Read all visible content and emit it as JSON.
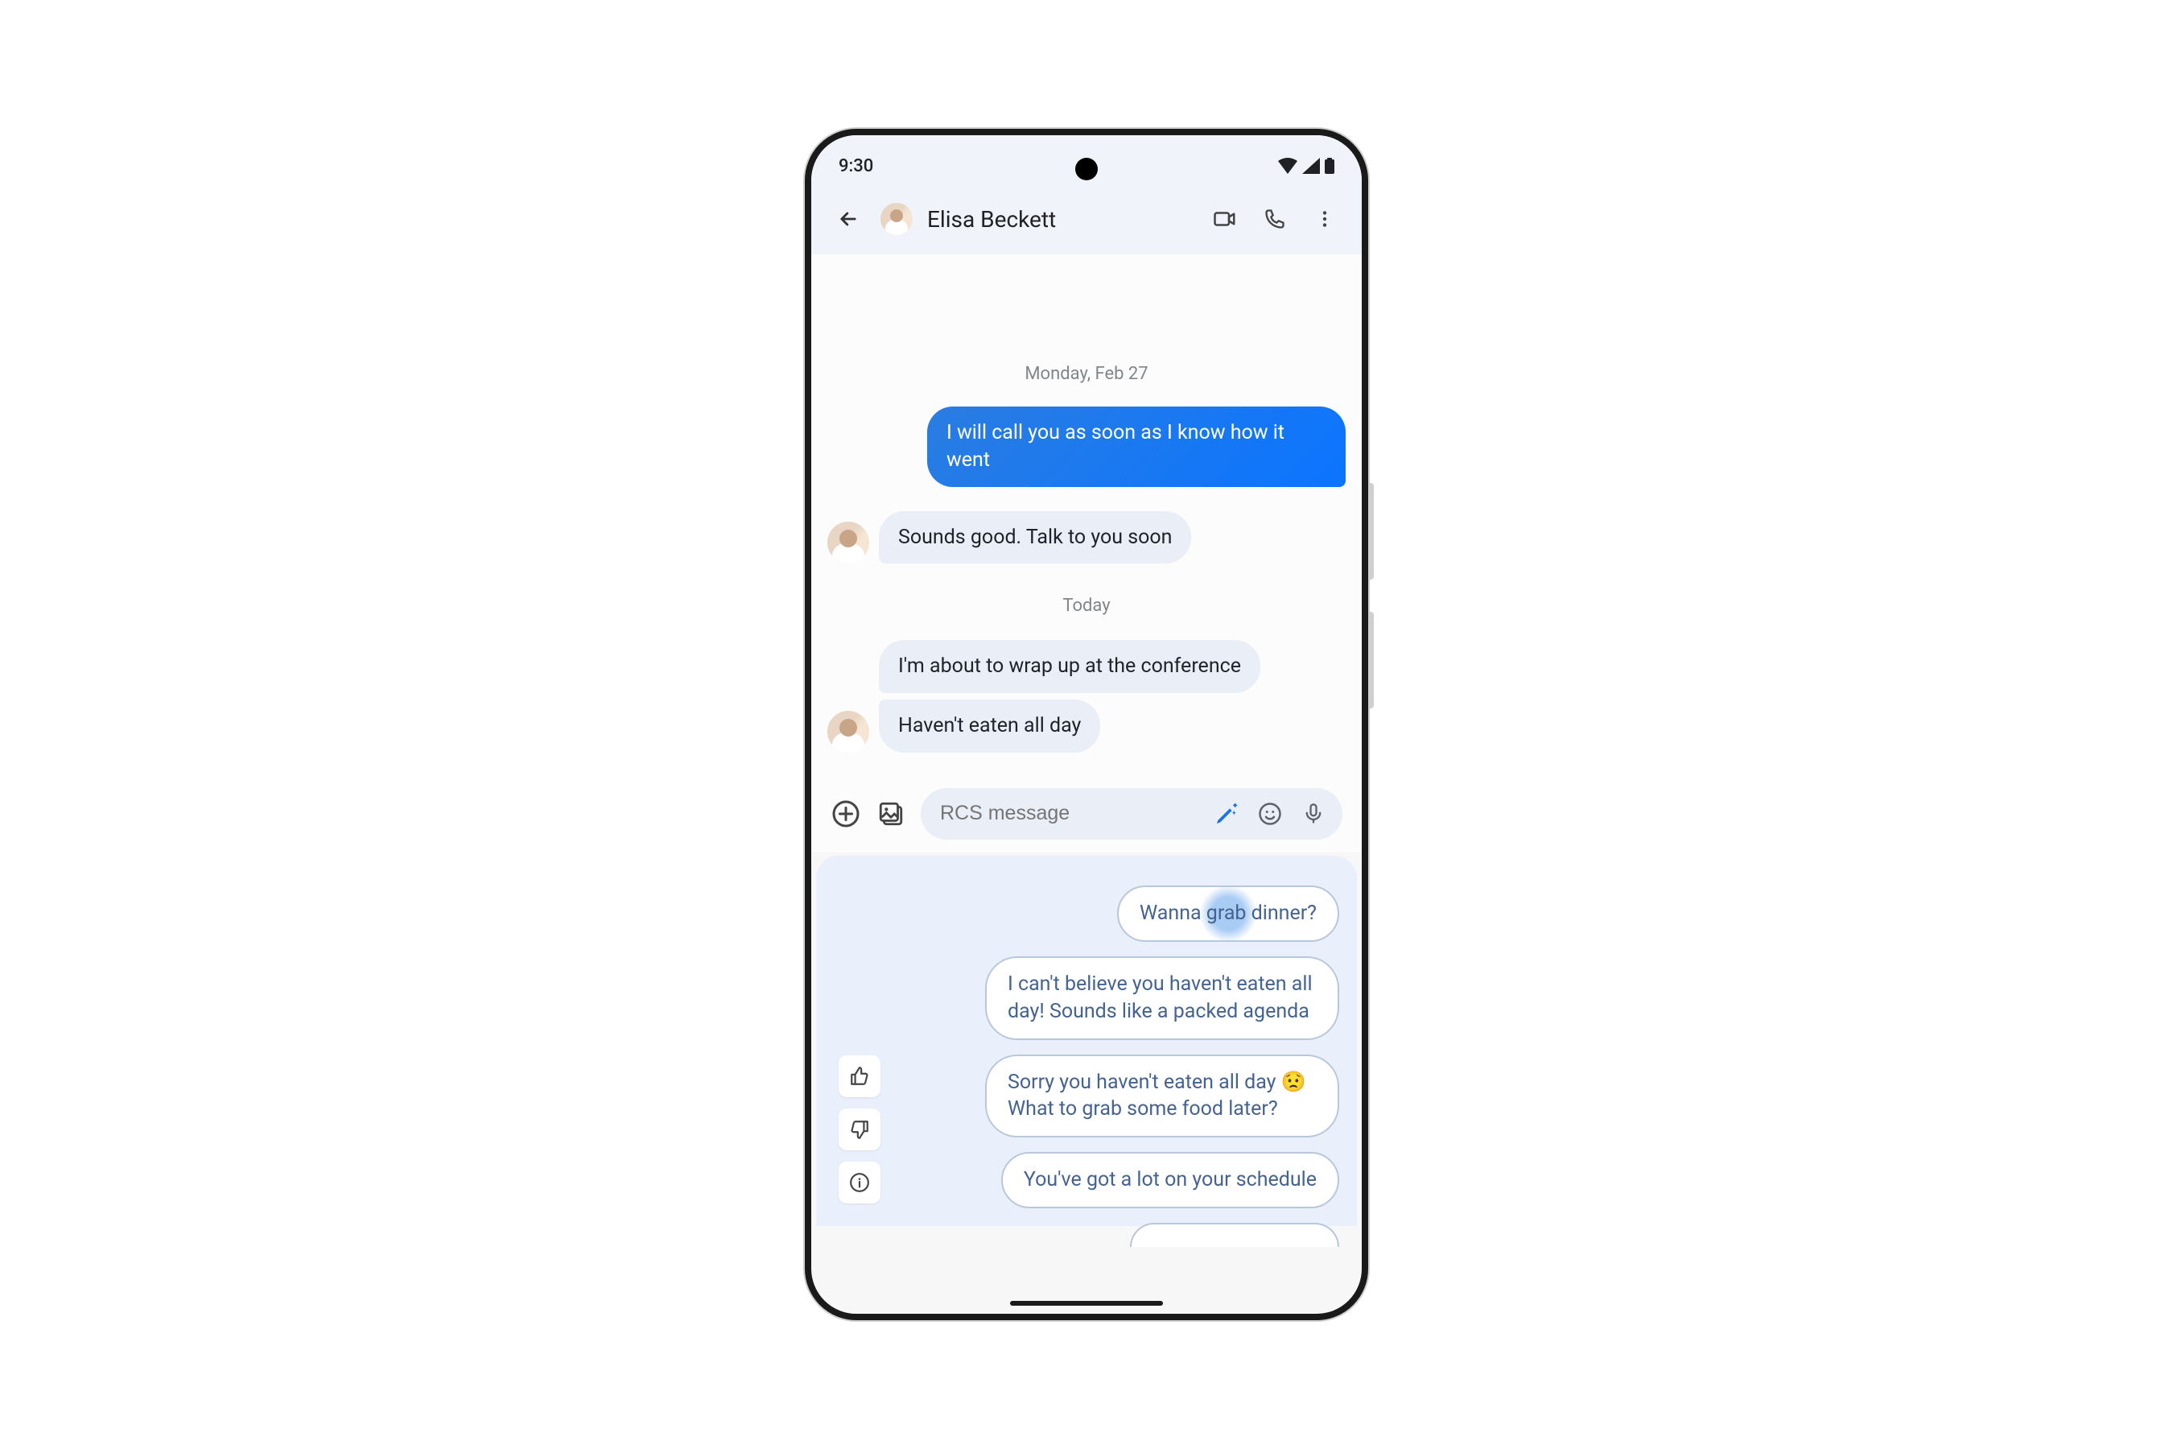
{
  "status": {
    "time": "9:30"
  },
  "header": {
    "contact_name": "Elisa Beckett"
  },
  "conversation": {
    "date_1": "Monday, Feb 27",
    "msg_sent_1": "I will call you as soon as I know how it went",
    "msg_recv_1": "Sounds good. Talk to you soon",
    "date_2": "Today",
    "msg_recv_2a": "I'm about to wrap up at the conference",
    "msg_recv_2b": "Haven't eaten all day"
  },
  "compose": {
    "placeholder": "RCS message"
  },
  "suggestions": {
    "chip_1": "Wanna grab dinner?",
    "chip_2": "I can't believe you haven't eaten all day! Sounds like a packed agenda",
    "chip_3": "Sorry you haven't eaten all day 😟 What to grab some food later?",
    "chip_4": "You've got a lot on your schedule"
  },
  "colors": {
    "sent_gradient_start": "#2a7de1",
    "sent_gradient_end": "#0b74ff",
    "received_bg": "#e9eef7",
    "panel_bg": "#eaf0fb",
    "chip_border": "#b9c7db",
    "chip_text": "#446390"
  }
}
